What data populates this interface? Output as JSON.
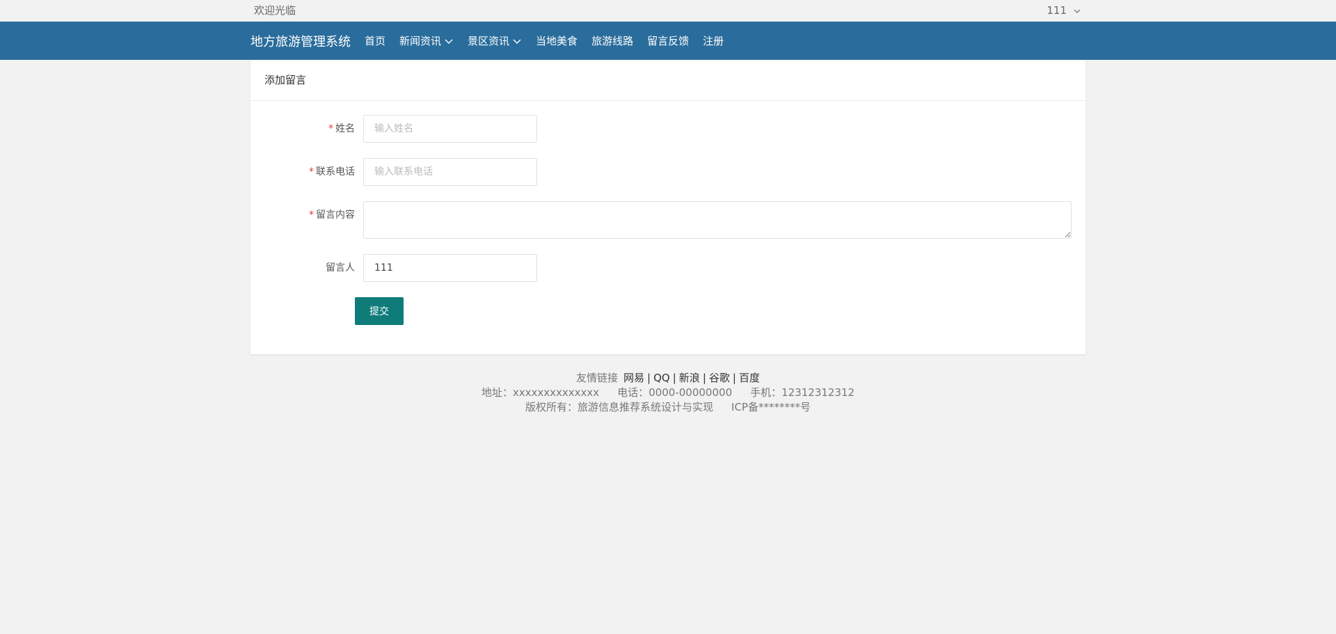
{
  "topbar": {
    "welcome": "欢迎光临",
    "username": "111"
  },
  "navbar": {
    "brand": "地方旅游管理系统",
    "items": [
      {
        "label": "首页",
        "dropdown": false
      },
      {
        "label": "新闻资讯",
        "dropdown": true
      },
      {
        "label": "景区资讯",
        "dropdown": true
      },
      {
        "label": "当地美食",
        "dropdown": false
      },
      {
        "label": "旅游线路",
        "dropdown": false
      },
      {
        "label": "留言反馈",
        "dropdown": false
      },
      {
        "label": "注册",
        "dropdown": false
      }
    ]
  },
  "form": {
    "title": "添加留言",
    "fields": {
      "name": {
        "label": "姓名",
        "required": true,
        "placeholder": "输入姓名",
        "value": ""
      },
      "phone": {
        "label": "联系电话",
        "required": true,
        "placeholder": "输入联系电话",
        "value": ""
      },
      "content": {
        "label": "留言内容",
        "required": true,
        "placeholder": "",
        "value": ""
      },
      "author": {
        "label": "留言人",
        "required": false,
        "placeholder": "",
        "value": "111"
      }
    },
    "required_mark": "*",
    "submit_label": "提交"
  },
  "footer": {
    "links_label": "友情链接",
    "links": [
      "网易",
      "QQ",
      "新浪",
      "谷歌",
      "百度"
    ],
    "link_separator": "|",
    "address": "地址：xxxxxxxxxxxxxx",
    "phone": "电话：0000-00000000",
    "mobile": "手机：12312312312",
    "copyright": "版权所有：旅游信息推荐系统设计与实现",
    "icp": "ICP备********号"
  },
  "colors": {
    "navbar": "#2a6d9c",
    "submit_button": "#0f7c7a",
    "required_mark": "#e4393c",
    "background": "#f2f2f2"
  },
  "icons": {
    "dropdown": "chevron-down-icon"
  }
}
